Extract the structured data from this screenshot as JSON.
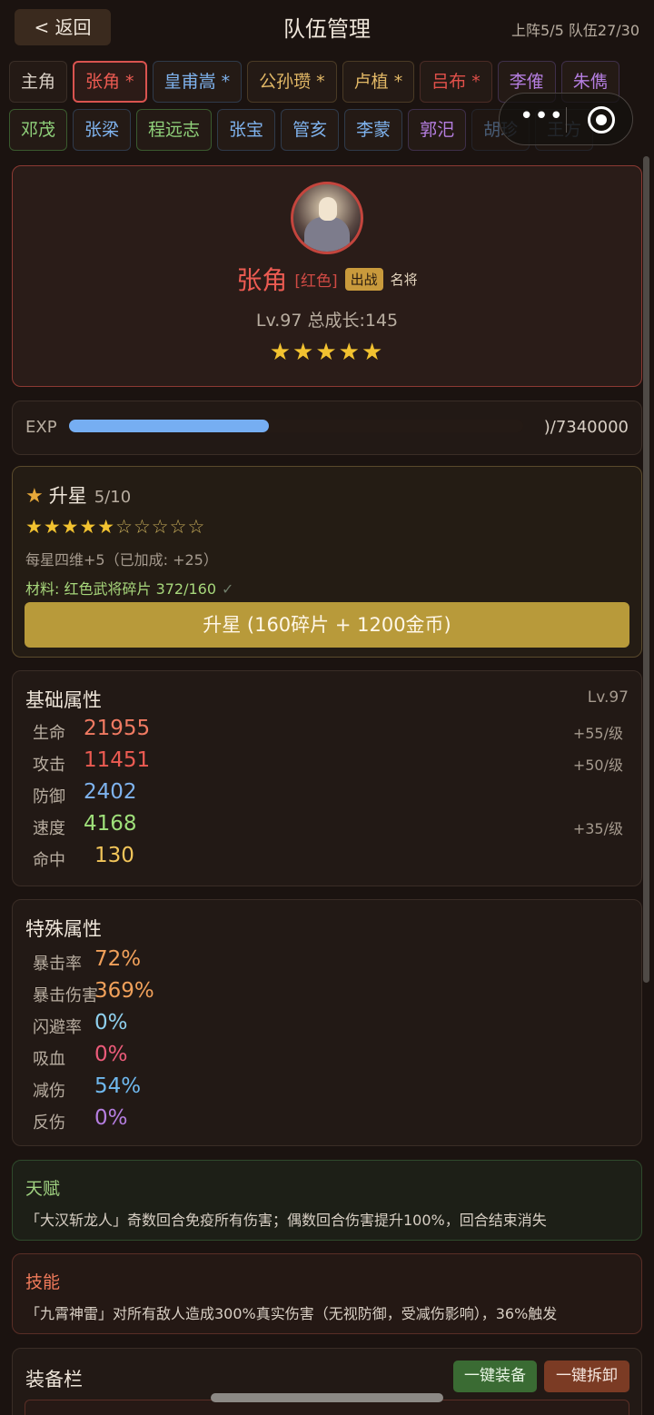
{
  "header": {
    "back_label": "< 返回",
    "title": "队伍管理",
    "stats": "上阵5/5 队伍27/30"
  },
  "tabs_row1": [
    {
      "label": "主角",
      "style": "t-white"
    },
    {
      "label": "张角 *",
      "style": "t-active"
    },
    {
      "label": "皇甫嵩 *",
      "style": "t-blue"
    },
    {
      "label": "公孙瓒 *",
      "style": "t-gold"
    },
    {
      "label": "卢植 *",
      "style": "t-gold"
    },
    {
      "label": "吕布 *",
      "style": "t-red"
    },
    {
      "label": "李傕",
      "style": "t-purple"
    },
    {
      "label": "朱儁",
      "style": "t-purple"
    }
  ],
  "tabs_row2": [
    {
      "label": "邓茂",
      "style": "t-green"
    },
    {
      "label": "张梁",
      "style": "t-blue"
    },
    {
      "label": "程远志",
      "style": "t-green"
    },
    {
      "label": "张宝",
      "style": "t-blue"
    },
    {
      "label": "管亥",
      "style": "t-blue"
    },
    {
      "label": "李蒙",
      "style": "t-blue"
    },
    {
      "label": "郭汜",
      "style": "t-purple"
    },
    {
      "label": "胡珍",
      "style": "t-blue t-fade"
    },
    {
      "label": "王方",
      "style": "t-blue t-fade"
    }
  ],
  "hero": {
    "name": "张角",
    "rarity": "[红色]",
    "badge": "出战",
    "rank": "名将",
    "level_line": "Lv.97  总成长:145",
    "stars": "★★★★★"
  },
  "exp": {
    "label": "EXP",
    "value_text": ")/7340000",
    "fill_fraction": 0.44
  },
  "upgrade_star": {
    "title": "升星",
    "count": "5/10",
    "stars_on": "★★★★★",
    "stars_off": "☆☆☆☆☆",
    "bonus": "每星四维+5（已加成: +25）",
    "material": "材料: 红色武将碎片 372/160",
    "check": "✓",
    "button": "升星 (160碎片 + 1200金币)"
  },
  "base_attrs": {
    "title": "基础属性",
    "level": "Lv.97",
    "rows": [
      {
        "name": "生命",
        "value": "21955",
        "growth": "+55/级",
        "color": "#f07a62"
      },
      {
        "name": "攻击",
        "value": "11451",
        "growth": "+50/级",
        "color": "#ec5b52"
      },
      {
        "name": "防御",
        "value": "2402",
        "growth": "",
        "color": "#7fb3ee"
      },
      {
        "name": "速度",
        "value": "4168",
        "growth": "+35/级",
        "color": "#9fe07a"
      },
      {
        "name": "命中",
        "value": "130",
        "growth": "",
        "color": "#f2c55a"
      }
    ]
  },
  "special_attrs": {
    "title": "特殊属性",
    "rows": [
      {
        "name": "暴击率",
        "value": "72%",
        "color": "#f0a05a"
      },
      {
        "name": "暴击伤害",
        "value": "369%",
        "color": "#f0a05a"
      },
      {
        "name": "闪避率",
        "value": "0%",
        "color": "#8fd0ee"
      },
      {
        "name": "吸血",
        "value": "0%",
        "color": "#ec5b7a"
      },
      {
        "name": "减伤",
        "value": "54%",
        "color": "#6fb8ee"
      },
      {
        "name": "反伤",
        "value": "0%",
        "color": "#b57ee0"
      }
    ]
  },
  "talent": {
    "title": "天赋",
    "desc": "「大汉斩龙人」奇数回合免疫所有伤害；偶数回合伤害提升100%，回合结束消失"
  },
  "skill": {
    "title": "技能",
    "desc": "「九霄神雷」对所有敌人造成300%真实伤害（无视防御，受减伤影响），36%触发"
  },
  "equipment": {
    "title": "装备栏",
    "equip_all": "一键装备",
    "unequip_all": "一键拆卸"
  },
  "colors": {
    "accent_gold": "#b89a3a",
    "hero_red": "#ec5b52",
    "exp_blue": "#76aef2"
  }
}
